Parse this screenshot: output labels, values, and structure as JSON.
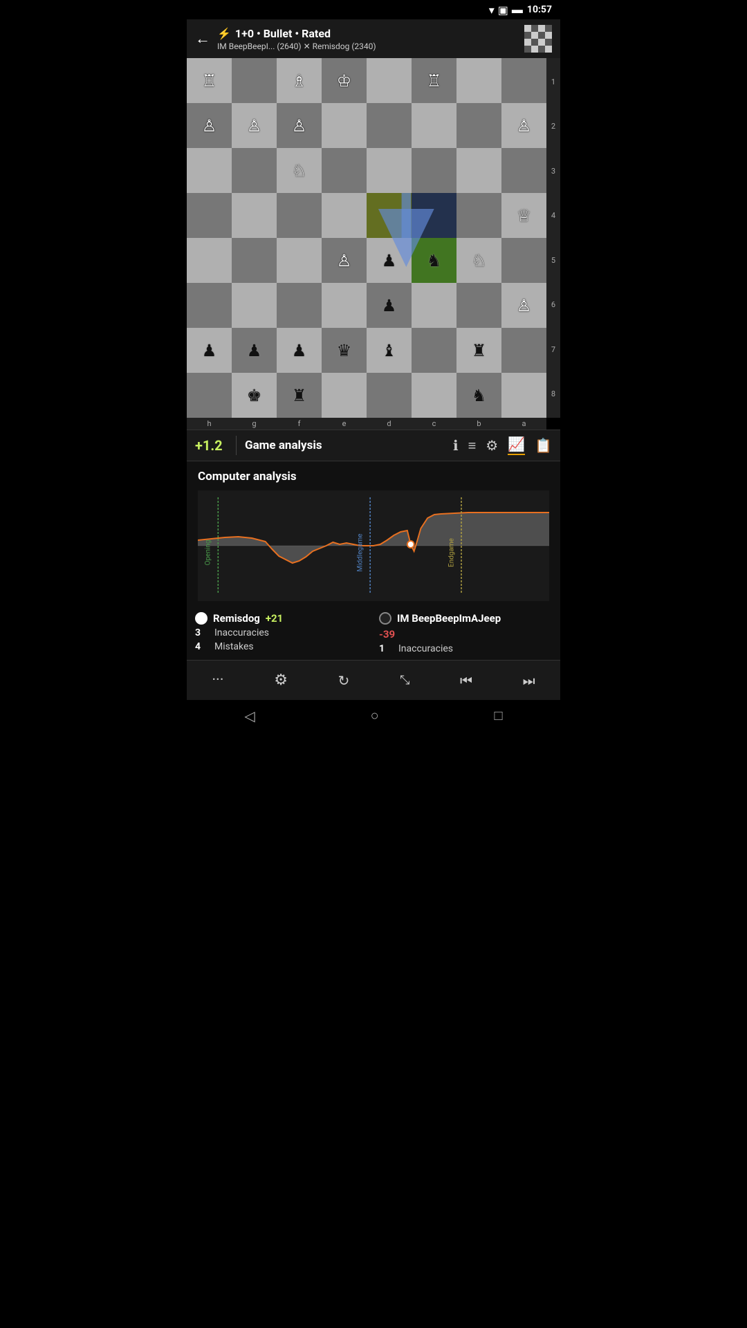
{
  "statusBar": {
    "time": "10:57"
  },
  "header": {
    "backLabel": "←",
    "gameType": "1+0 • Bullet • Rated",
    "players": "IM BeepBeepI... (2640) ✕ Remisdog (2340)"
  },
  "toolbar": {
    "evalScore": "+1.2",
    "title": "Game analysis"
  },
  "analysis": {
    "sectionTitle": "Computer analysis"
  },
  "players": {
    "white": {
      "name": "Remisdog",
      "score": "+21",
      "inaccuracies": "3",
      "inaccuraciesLabel": "Inaccuracies",
      "mistakes": "4",
      "mistakesLabel": "Mistakes"
    },
    "black": {
      "name": "IM BeepBeepImAJeep",
      "score": "-39",
      "inaccuracies": "1",
      "inaccuraciesLabel": "Inaccuracies"
    }
  },
  "bottomNav": {
    "more": "···",
    "settings": "⚙",
    "reload": "↻",
    "resize": "⤢",
    "prev": "⏮",
    "next": "⏭"
  },
  "androidNav": {
    "back": "◁",
    "home": "○",
    "recent": "□"
  },
  "board": {
    "ranks": [
      "1",
      "2",
      "3",
      "4",
      "5",
      "6",
      "7",
      "8"
    ],
    "files": [
      "h",
      "g",
      "f",
      "e",
      "d",
      "c",
      "b",
      "a"
    ]
  }
}
